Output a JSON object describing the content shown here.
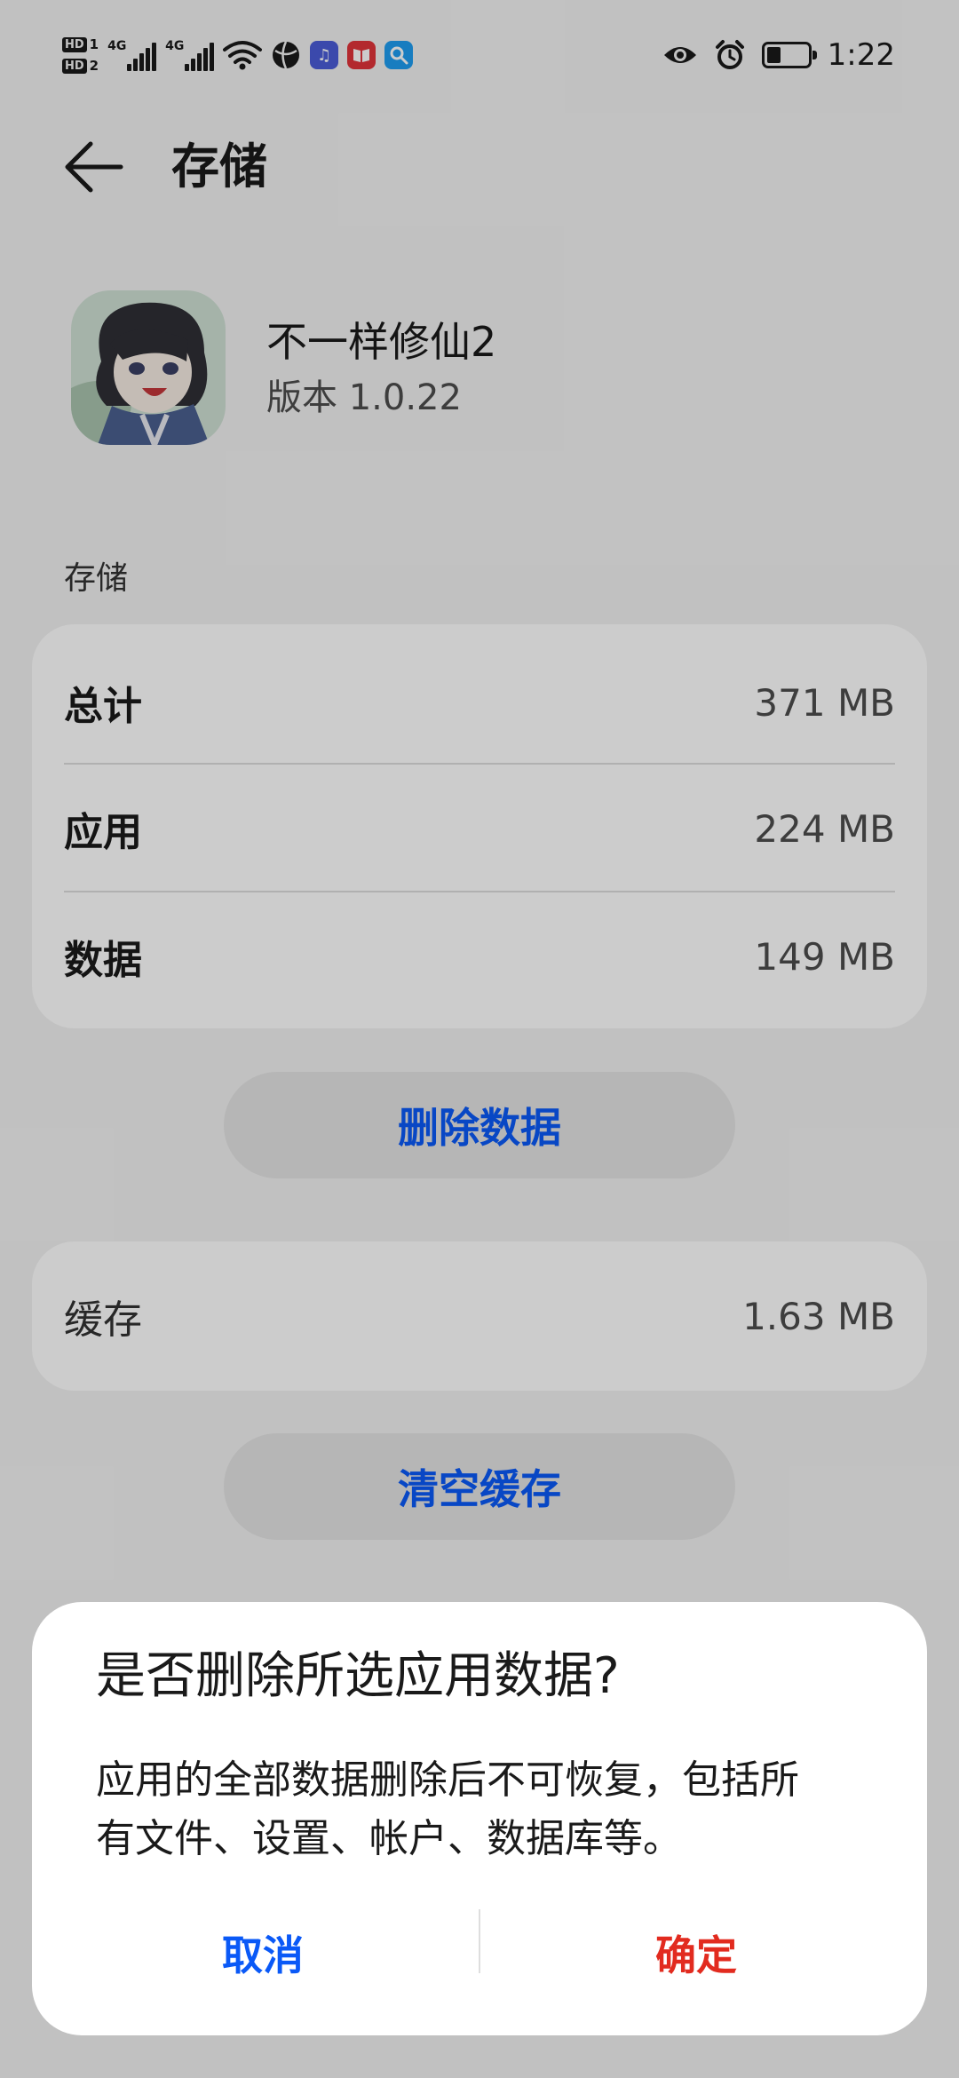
{
  "status_bar": {
    "sim1_label": "HD",
    "sim1_num": "1",
    "sim2_label": "HD",
    "sim2_num": "2",
    "net1": "4G",
    "net2": "4G",
    "time": "1:22",
    "battery_level": 0.35,
    "notification_icons": [
      "wifi-icon",
      "ball-app-icon",
      "music-app-icon",
      "red-book-app-icon",
      "search-app-icon"
    ],
    "right_icons": [
      "eye-icon",
      "alarm-icon",
      "battery-icon"
    ]
  },
  "header": {
    "title": "存储"
  },
  "app": {
    "name": "不一样修仙2",
    "version": "版本 1.0.22"
  },
  "storage": {
    "section_label": "存储",
    "rows": [
      {
        "label": "总计",
        "value": "371 MB"
      },
      {
        "label": "应用",
        "value": "224 MB"
      },
      {
        "label": "数据",
        "value": "149 MB"
      }
    ],
    "delete_button": "删除数据"
  },
  "cache": {
    "label": "缓存",
    "value": "1.63 MB",
    "clear_button": "清空缓存"
  },
  "dialog": {
    "title": "是否删除所选应用数据?",
    "body_line1": "应用的全部数据删除后不可恢复，包括所",
    "body_line2": "有文件、设置、帐户、数据库等。",
    "cancel": "取消",
    "confirm": "确定"
  },
  "colors": {
    "accent": "#0a59f7",
    "danger": "#e22b1f",
    "background": "#f2f2f2",
    "card": "#ffffff"
  }
}
